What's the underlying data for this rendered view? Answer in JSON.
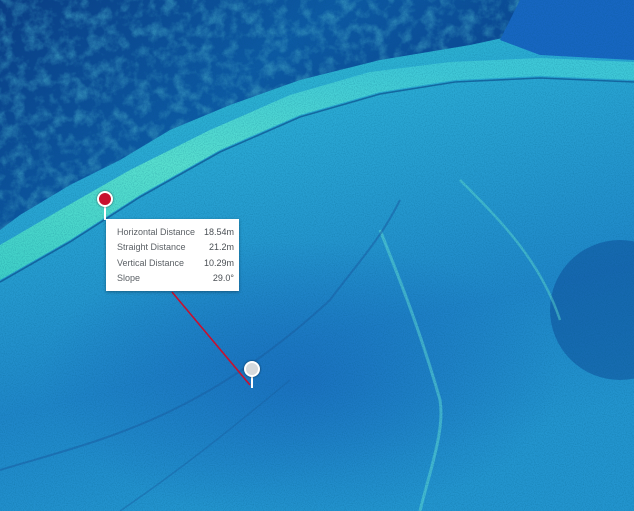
{
  "map": {
    "colors": {
      "deep": "#0a2a6e",
      "mid": "#1f86c9",
      "shallow": "#2ed1c5",
      "ridge": "#6fe3d4",
      "measure_line": "#c8102e"
    }
  },
  "markers": {
    "start": {
      "icon": "map-pin-icon",
      "color": "#c8102e"
    },
    "end": {
      "icon": "map-pin-icon",
      "color": "#d6dadd"
    }
  },
  "measurement": {
    "rows": [
      {
        "label": "Horizontal Distance",
        "value": "18.54m"
      },
      {
        "label": "Straight Distance",
        "value": "21.2m"
      },
      {
        "label": "Vertical Distance",
        "value": "10.29m"
      },
      {
        "label": "Slope",
        "value": "29.0°"
      }
    ]
  }
}
